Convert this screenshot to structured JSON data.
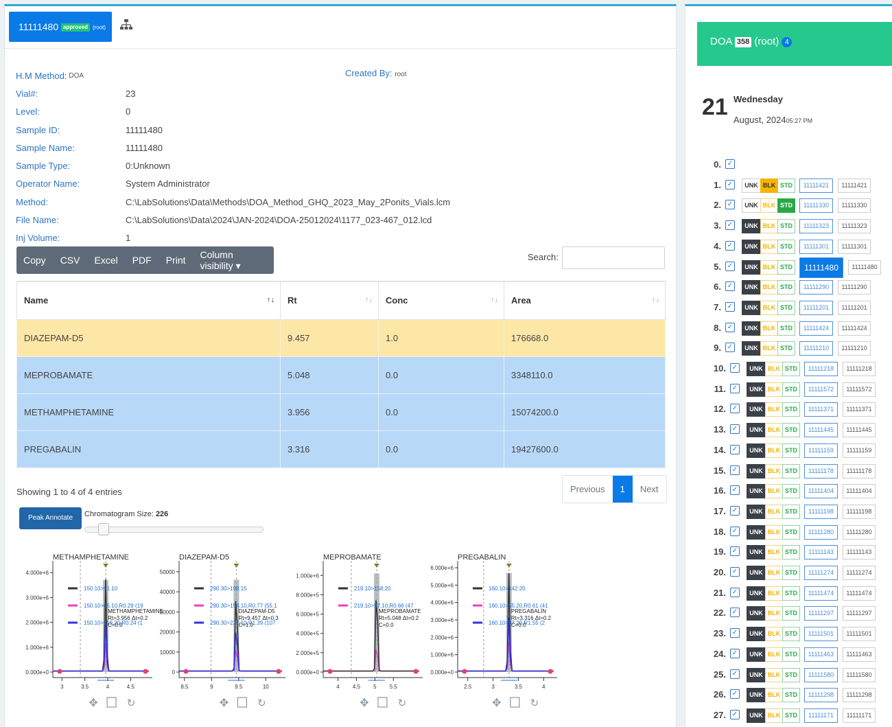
{
  "header": {
    "sample_number": "11111480",
    "status_badge": "approved",
    "owner": "(root)"
  },
  "meta": {
    "hm_method_label": "H.M Method:",
    "hm_method_value": "DOA",
    "created_by_label": "Created By:",
    "created_by_value": "root",
    "rows": [
      {
        "label": "Vial#:",
        "value": "23"
      },
      {
        "label": "Level:",
        "value": "0"
      },
      {
        "label": "Sample ID:",
        "value": "11111480"
      },
      {
        "label": "Sample Name:",
        "value": "11111480"
      },
      {
        "label": "Sample Type:",
        "value": "0:Unknown"
      },
      {
        "label": "Operator Name:",
        "value": "System Administrator"
      },
      {
        "label": "Method:",
        "value": "C:\\LabSolutions\\Data\\Methods\\DOA_Method_GHQ_2023_May_2Ponits_Vials.lcm"
      },
      {
        "label": "File Name:",
        "value": "C:\\LabSolutions\\Data\\2024\\JAN-2024\\DOA-25012024\\1177_023-467_012.lcd"
      },
      {
        "label": "Inj Volume:",
        "value": "1"
      }
    ]
  },
  "toolbar": {
    "copy": "Copy",
    "csv": "CSV",
    "excel": "Excel",
    "pdf": "PDF",
    "print": "Print",
    "colvis": "Column visibility ▾"
  },
  "search": {
    "label": "Search:",
    "placeholder": ""
  },
  "table": {
    "headers": [
      "Name",
      "Rt",
      "Conc",
      "Area"
    ],
    "rows": [
      {
        "name": "DIAZEPAM-D5",
        "rt": "9.457",
        "conc": "1.0",
        "area": "176668.0"
      },
      {
        "name": "MEPROBAMATE",
        "rt": "5.048",
        "conc": "0.0",
        "area": "3348110.0"
      },
      {
        "name": "METHAMPHETAMINE",
        "rt": "3.956",
        "conc": "0.0",
        "area": "15074200.0"
      },
      {
        "name": "PREGABALIN",
        "rt": "3.316",
        "conc": "0.0",
        "area": "19427600.0"
      }
    ],
    "showing": "Showing 1 to 4 of 4 entries"
  },
  "pager": {
    "previous": "Previous",
    "page": "1",
    "next": "Next"
  },
  "peak_annotate": "Peak Annotate",
  "chrom_size_label": "Chromatogram Size:",
  "chrom_size_value": "226",
  "chrom_size_level": 0.11,
  "chart_data": [
    {
      "type": "line",
      "title": "METHAMPHETAMINE",
      "xlim": [
        2.8,
        4.9
      ],
      "ylim": [
        0,
        4200000
      ],
      "xticks": [
        "3",
        "3.5",
        "4",
        "4.5"
      ],
      "xtick_vals": [
        3,
        3.5,
        4,
        4.5
      ],
      "yticks": [
        "0.000e+0",
        "1.000e+6",
        "2.000e+6",
        "3.000e+6",
        "4.000e+6"
      ],
      "ytick_vals": [
        0,
        1000000,
        2000000,
        3000000,
        4000000
      ],
      "peak_rt": 3.956,
      "peak_height": 3700000,
      "legend": [
        "150.10>91.10",
        "150.10>65.10,R0.29 (19",
        "150.10>119.20,R0.24 (1"
      ],
      "annotation": [
        "METHAMPHETAMINE",
        "Rt=3.956 Δt=0.2",
        "C=0.0"
      ]
    },
    {
      "type": "line",
      "title": "DIAZEPAM-D5",
      "xlim": [
        8.4,
        10.3
      ],
      "ylim": [
        0,
        52000
      ],
      "xticks": [
        "8.5",
        "9",
        "9.5",
        "10"
      ],
      "xtick_vals": [
        8.5,
        9,
        9.5,
        10
      ],
      "yticks": [
        "0",
        "10000",
        "20000",
        "30000",
        "40000",
        "50000"
      ],
      "ytick_vals": [
        0,
        10000,
        20000,
        30000,
        40000,
        50000
      ],
      "peak_rt": 9.457,
      "peak_height": 46000,
      "legend": [
        "290.30>198.15",
        "290.30>154.10,R0.77 (55.1",
        "290.30>227.10,R1.39 (107"
      ],
      "annotation": [
        "DIAZEPAM-D5",
        "Rt=9.457 Δt=0.3",
        "C=1.0"
      ]
    },
    {
      "type": "line",
      "title": "MEPROBAMATE",
      "xlim": [
        3.6,
        6.2
      ],
      "ylim": [
        0,
        1080000
      ],
      "xticks": [
        "4",
        "4.5",
        "5",
        "5.5"
      ],
      "xtick_vals": [
        4,
        4.5,
        5,
        5.5
      ],
      "yticks": [
        "0.000e+0",
        "2.000e+5",
        "4.000e+5",
        "6.000e+5",
        "8.000e+5",
        "1.000e+6"
      ],
      "ytick_vals": [
        0,
        200000,
        400000,
        600000,
        800000,
        1000000
      ],
      "peak_rt": 5.048,
      "peak_height": 1020000,
      "legend": [
        "219.10>158.20",
        "219.10>97.10,R0.66 (47"
      ],
      "annotation": [
        "MEPROBAMATE",
        "Rt=5.048 Δt=0.2",
        "C=0.0"
      ]
    },
    {
      "type": "line",
      "title": "PREGABALIN",
      "xlim": [
        2.3,
        4.2
      ],
      "ylim": [
        0,
        6000000
      ],
      "xticks": [
        "2.5",
        "3",
        "3.5",
        "4"
      ],
      "xtick_vals": [
        2.5,
        3,
        3.5,
        4
      ],
      "yticks": [
        "0.000e+0",
        "1.000e+6",
        "2.000e+6",
        "3.000e+6",
        "4.000e+6",
        "5.000e+6",
        "6.000e+6"
      ],
      "ytick_vals": [
        0,
        1000000,
        2000000,
        3000000,
        4000000,
        5000000,
        6000000
      ],
      "peak_rt": 3.316,
      "peak_height": 5700000,
      "legend": [
        "160.10>142.20",
        "160.10>55.20,R0.61 (41",
        "160.10>97.20,R1.55 (2"
      ],
      "annotation": [
        "PREGABALIN",
        "Rt=3.316 Δt=0.2",
        "C=0.0"
      ]
    }
  ],
  "sidebar": {
    "title": "DOA",
    "count": "358",
    "owner": "(root)",
    "owner_count": "4",
    "day": "21",
    "weekday": "Wednesday",
    "month_year": "August, 2024",
    "time": "05:27 PM",
    "tag_labels": {
      "unk": "UNK",
      "blk": "BLK",
      "std": "STD"
    },
    "vials": [
      {
        "n": "0.",
        "id": ""
      },
      {
        "n": "1.",
        "id": "11111421"
      },
      {
        "n": "2.",
        "id": "11111330"
      },
      {
        "n": "3.",
        "id": "11111323"
      },
      {
        "n": "4.",
        "id": "11111301"
      },
      {
        "n": "5.",
        "id": "11111480"
      },
      {
        "n": "6.",
        "id": "11111290"
      },
      {
        "n": "7.",
        "id": "11111201"
      },
      {
        "n": "8.",
        "id": "11111424"
      },
      {
        "n": "9.",
        "id": "11111210"
      },
      {
        "n": "10.",
        "id": "11111218"
      },
      {
        "n": "11.",
        "id": "11111572"
      },
      {
        "n": "12.",
        "id": "11111371"
      },
      {
        "n": "13.",
        "id": "11111445"
      },
      {
        "n": "14.",
        "id": "11111159"
      },
      {
        "n": "15.",
        "id": "11111178"
      },
      {
        "n": "16.",
        "id": "11111404"
      },
      {
        "n": "17.",
        "id": "11111198"
      },
      {
        "n": "18.",
        "id": "11111280"
      },
      {
        "n": "19.",
        "id": "11111143"
      },
      {
        "n": "20.",
        "id": "11111274"
      },
      {
        "n": "21.",
        "id": "11111474"
      },
      {
        "n": "22.",
        "id": "11111297"
      },
      {
        "n": "23.",
        "id": "11111501"
      },
      {
        "n": "24.",
        "id": "11111463"
      },
      {
        "n": "25.",
        "id": "11111580"
      },
      {
        "n": "26.",
        "id": "11111298"
      },
      {
        "n": "27.",
        "id": "11111171"
      }
    ]
  },
  "colors": {
    "accent": "#0a7ae6",
    "green_header": "#25c88d",
    "row_highlight": "#fde7a7",
    "row_blue": "#b8d8f8",
    "trace1": "#333333",
    "trace2": "#e83fbf",
    "trace3": "#3333dd"
  }
}
